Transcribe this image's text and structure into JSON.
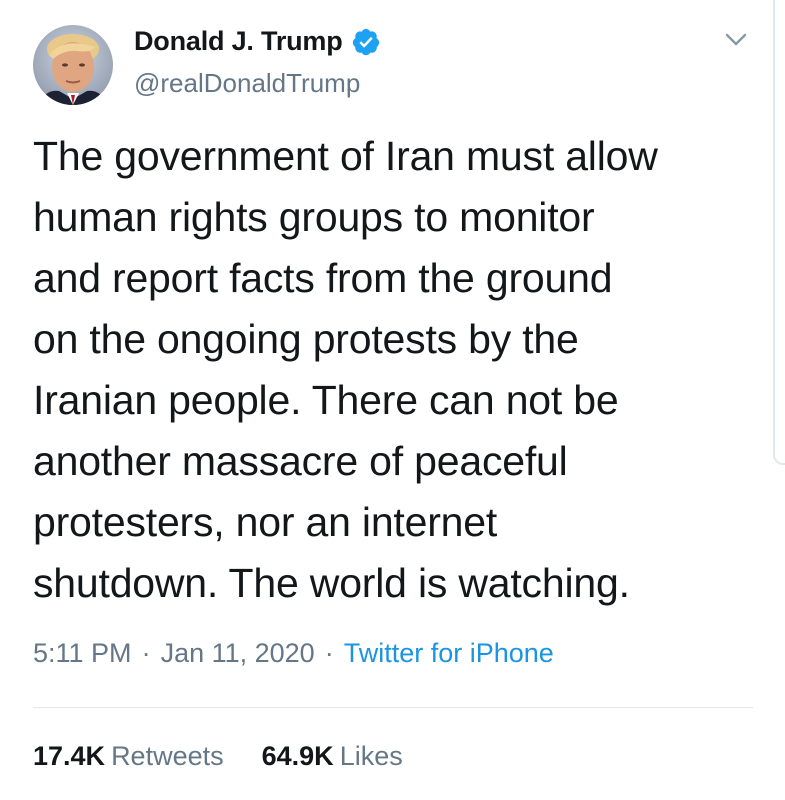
{
  "author": {
    "display_name": "Donald J. Trump",
    "handle": "@realDonaldTrump",
    "verified": true,
    "avatar_icon": "profile-photo"
  },
  "tweet": {
    "text": "The government of Iran must allow\nhuman rights groups to monitor\nand report facts from the ground\non the ongoing protests by the\nIranian people. There can not be\nanother massacre of peaceful\nprotesters, nor an internet\nshutdown. The world is watching."
  },
  "meta": {
    "time": "5:11 PM",
    "separator": "·",
    "date": "Jan 11, 2020",
    "source": "Twitter for iPhone"
  },
  "stats": {
    "retweets_count": "17.4K",
    "retweets_label": "Retweets",
    "likes_count": "64.9K",
    "likes_label": "Likes"
  },
  "colors": {
    "text": "#14171a",
    "secondary": "#657786",
    "accent": "#1b95e0",
    "verified": "#1da1f2",
    "divider": "#e1e8ed"
  },
  "icons": {
    "verified": "verified-badge-icon",
    "menu": "chevron-down-icon"
  }
}
